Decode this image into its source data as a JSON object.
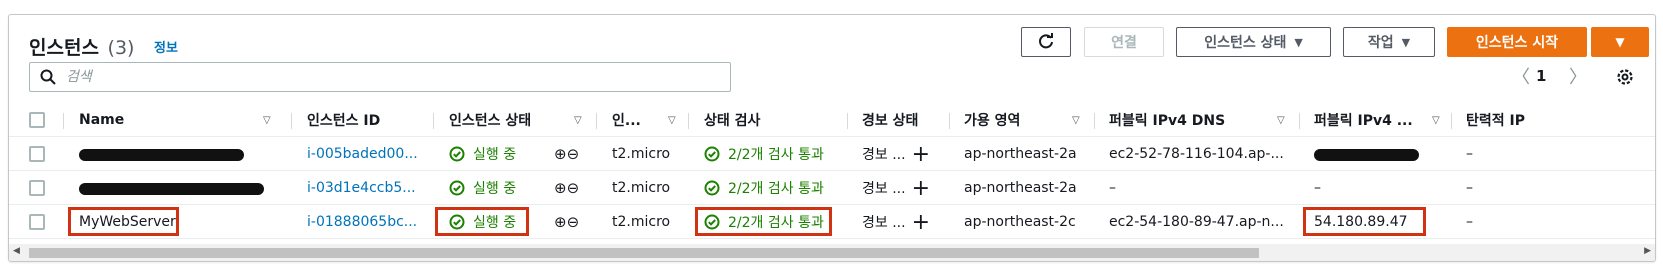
{
  "header": {
    "title": "인스턴스",
    "count": "(3)",
    "info": "정보",
    "connect_label": "연결",
    "state_label": "인스턴스 상태",
    "action_label": "작업",
    "start_label": "인스턴스 시작"
  },
  "search": {
    "placeholder": "검색"
  },
  "pagination": {
    "page": "1",
    "prev": "〈",
    "next": "〉"
  },
  "columns": [
    "Name",
    "인스턴스 ID",
    "인스턴스 상태",
    "인...",
    "상태 검사",
    "경보 상태",
    "가용 영역",
    "퍼블릭 IPv4 DNS",
    "퍼블릭 IPv4 ...",
    "탄력적 IP"
  ],
  "rows": [
    {
      "name": "",
      "id": "i-005baded00...",
      "state": "실행 중",
      "type": "t2.micro",
      "check": "2/2개 검사 통과",
      "alarm": "경보 ...",
      "az": "ap-northeast-2a",
      "dns": "ec2-52-78-116-104.ap-...",
      "ip": "",
      "eip": "–"
    },
    {
      "name": "",
      "id": "i-03d1e4ccb5...",
      "state": "실행 중",
      "type": "t2.micro",
      "check": "2/2개 검사 통과",
      "alarm": "경보 ...",
      "az": "ap-northeast-2a",
      "dns": "–",
      "ip": "–",
      "eip": "–"
    },
    {
      "name": "MyWebServer",
      "id": "i-01888065bc...",
      "state": "실행 중",
      "type": "t2.micro",
      "check": "2/2개 검사 통과",
      "alarm": "경보 ...",
      "az": "ap-northeast-2c",
      "dns": "ec2-54-180-89-47.ap-n...",
      "ip": "54.180.89.47",
      "eip": "–"
    }
  ],
  "colors": {
    "accent": "#ec7211",
    "link": "#0073bb",
    "success": "#1d8102",
    "highlight": "#d13212"
  },
  "icons": {
    "refresh": "refresh-icon",
    "search": "search-icon",
    "settings": "gear-icon",
    "status": "check-circle-icon",
    "zoom": "zoom-in-out-icon"
  }
}
